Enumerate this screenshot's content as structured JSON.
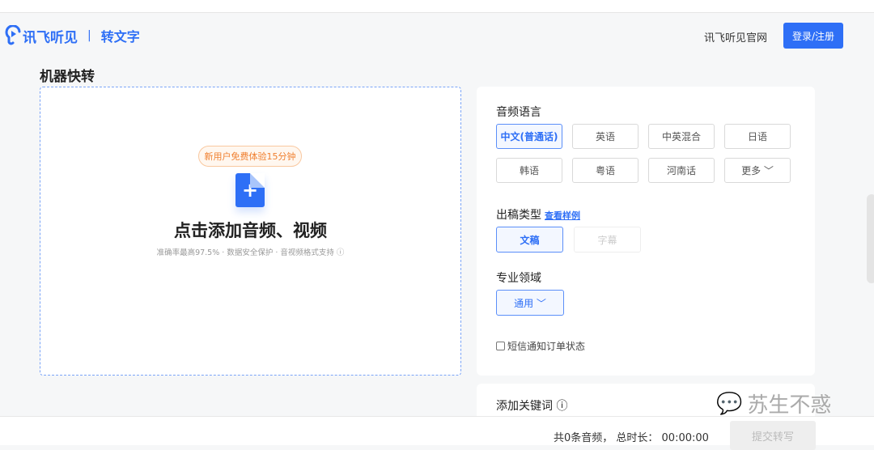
{
  "header": {
    "brand": "讯飞听见",
    "product": "转文字",
    "official_site": "讯飞听见官网",
    "login": "登录/注册"
  },
  "page_title": "机器快转",
  "upload": {
    "promo": "新用户免费体验15分钟",
    "main": "点击添加音频、视频",
    "hint": "准确率最高97.5% · 数据安全保护 · 音视频格式支持 ⓘ"
  },
  "settings": {
    "language_label": "音频语言",
    "languages": [
      "中文(普通话)",
      "英语",
      "中英混合",
      "日语",
      "韩语",
      "粤语",
      "河南话",
      "更多 ﹀"
    ],
    "output_label": "出稿类型",
    "sample_link": "查看样例",
    "outputs": [
      "文稿",
      "字幕"
    ],
    "domain_label": "专业领域",
    "domain_value": "通用 ﹀",
    "sms_label": "短信通知订单状态",
    "keywords_label": "添加关键词 ⓘ"
  },
  "footer": {
    "summary": "共0条音频， 总时长： 00:00:00",
    "submit": "提交转写"
  },
  "watermark": "苏生不惑",
  "colors": {
    "accent": "#2e6ff6",
    "promo": "#f08030"
  }
}
